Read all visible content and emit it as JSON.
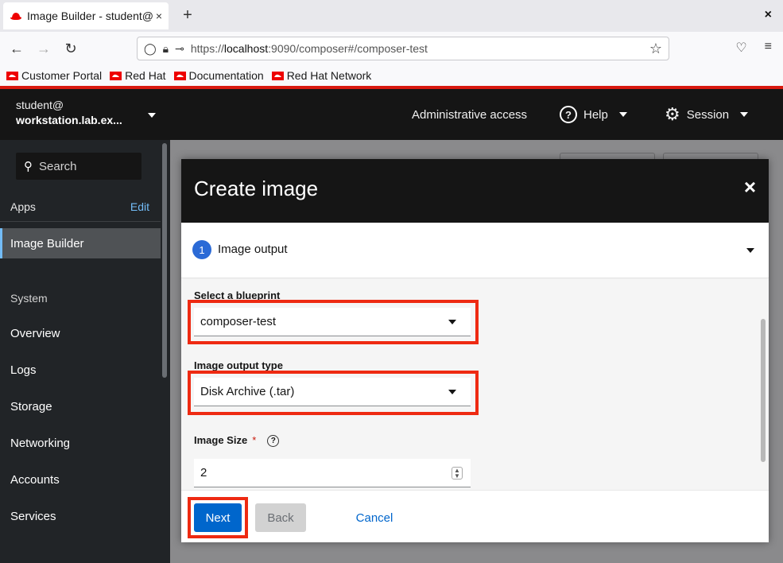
{
  "browser": {
    "tab_title": "Image Builder - student@",
    "tab_close": "×",
    "new_tab": "+",
    "window_close": "×",
    "url_prefix": "https://",
    "url_host": "localhost",
    "url_rest": ":9090/composer#/composer-test",
    "bookmarks": [
      "Customer Portal",
      "Red Hat",
      "Documentation",
      "Red Hat Network"
    ]
  },
  "header": {
    "admin_access": "Administrative access",
    "help": "Help",
    "session": "Session"
  },
  "sidebar": {
    "user": "student@",
    "host": "workstation.lab.ex...",
    "search_placeholder": "Search",
    "apps_label": "Apps",
    "edit_label": "Edit",
    "active_item": "Image Builder",
    "system_label": "System",
    "items": [
      "Overview",
      "Logs",
      "Storage",
      "Networking",
      "Accounts",
      "Services"
    ]
  },
  "modal": {
    "title": "Create image",
    "close": "×",
    "step_number": "1",
    "step_label": "Image output",
    "blueprint_label": "Select a blueprint",
    "blueprint_value": "composer-test",
    "output_type_label": "Image output type",
    "output_type_value": "Disk Archive (.tar)",
    "size_label": "Image Size",
    "size_required": "*",
    "size_help": "?",
    "size_value": "2",
    "next": "Next",
    "back": "Back",
    "cancel": "Cancel"
  },
  "colors": {
    "highlight": "#ee2a12",
    "primary": "#0066cc",
    "brand_red": "#d9190f"
  }
}
